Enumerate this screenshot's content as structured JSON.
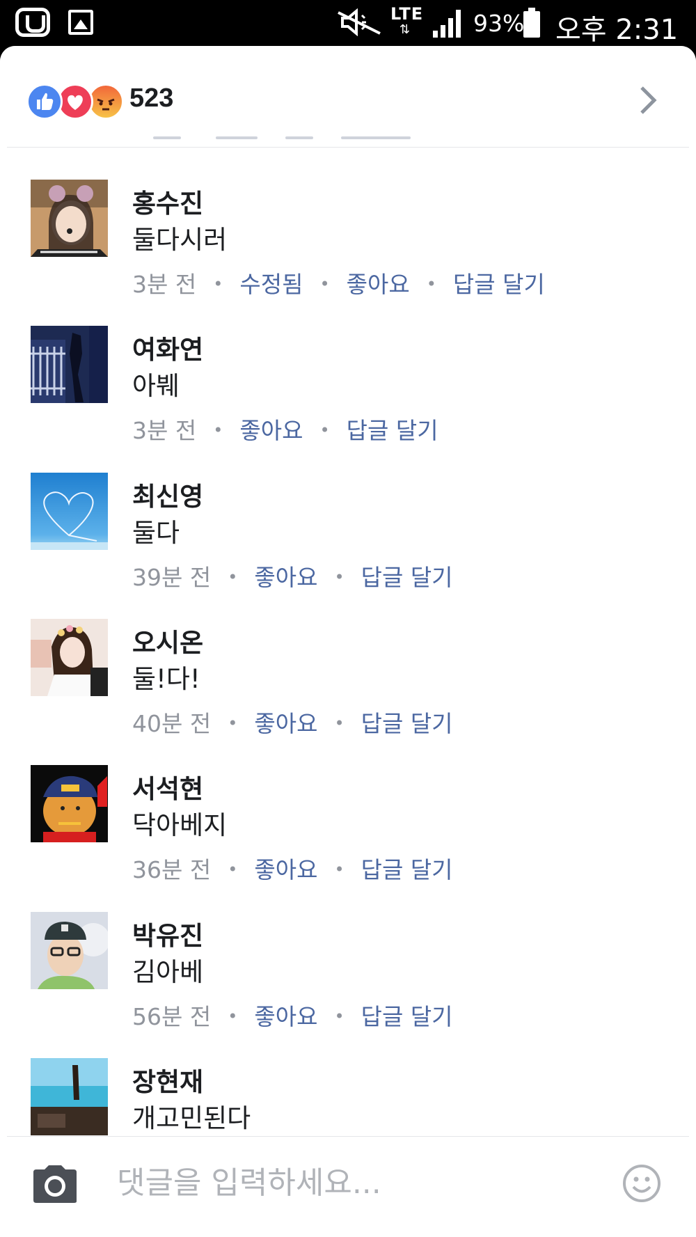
{
  "status_bar": {
    "network": "LTE",
    "battery": "93%",
    "time": "오후 2:31"
  },
  "reactions": {
    "count": "523",
    "types": [
      "like",
      "love",
      "angry"
    ]
  },
  "comments": [
    {
      "name": "홍수진",
      "text": "둘다시러",
      "time": "3분 전",
      "edited": "수정됨",
      "like": "좋아요",
      "reply": "답글 달기"
    },
    {
      "name": "여화연",
      "text": "아붸",
      "time": "3분 전",
      "like": "좋아요",
      "reply": "답글 달기"
    },
    {
      "name": "최신영",
      "text": "둘다",
      "time": "39분 전",
      "like": "좋아요",
      "reply": "답글 달기"
    },
    {
      "name": "오시온",
      "text": "둘!다!",
      "time": "40분 전",
      "like": "좋아요",
      "reply": "답글 달기"
    },
    {
      "name": "서석현",
      "text": "닥아베지",
      "time": "36분 전",
      "like": "좋아요",
      "reply": "답글 달기"
    },
    {
      "name": "박유진",
      "text": "김아베",
      "time": "56분 전",
      "like": "좋아요",
      "reply": "답글 달기"
    },
    {
      "name": "장현재",
      "text": "개고민된다"
    }
  ],
  "composer": {
    "placeholder": "댓글을 입력하세요..."
  },
  "colors": {
    "link": "#4b67a1",
    "meta": "#90949c",
    "text": "#1c1e21",
    "like": "#4c86f0",
    "love": "#ee3e57"
  }
}
